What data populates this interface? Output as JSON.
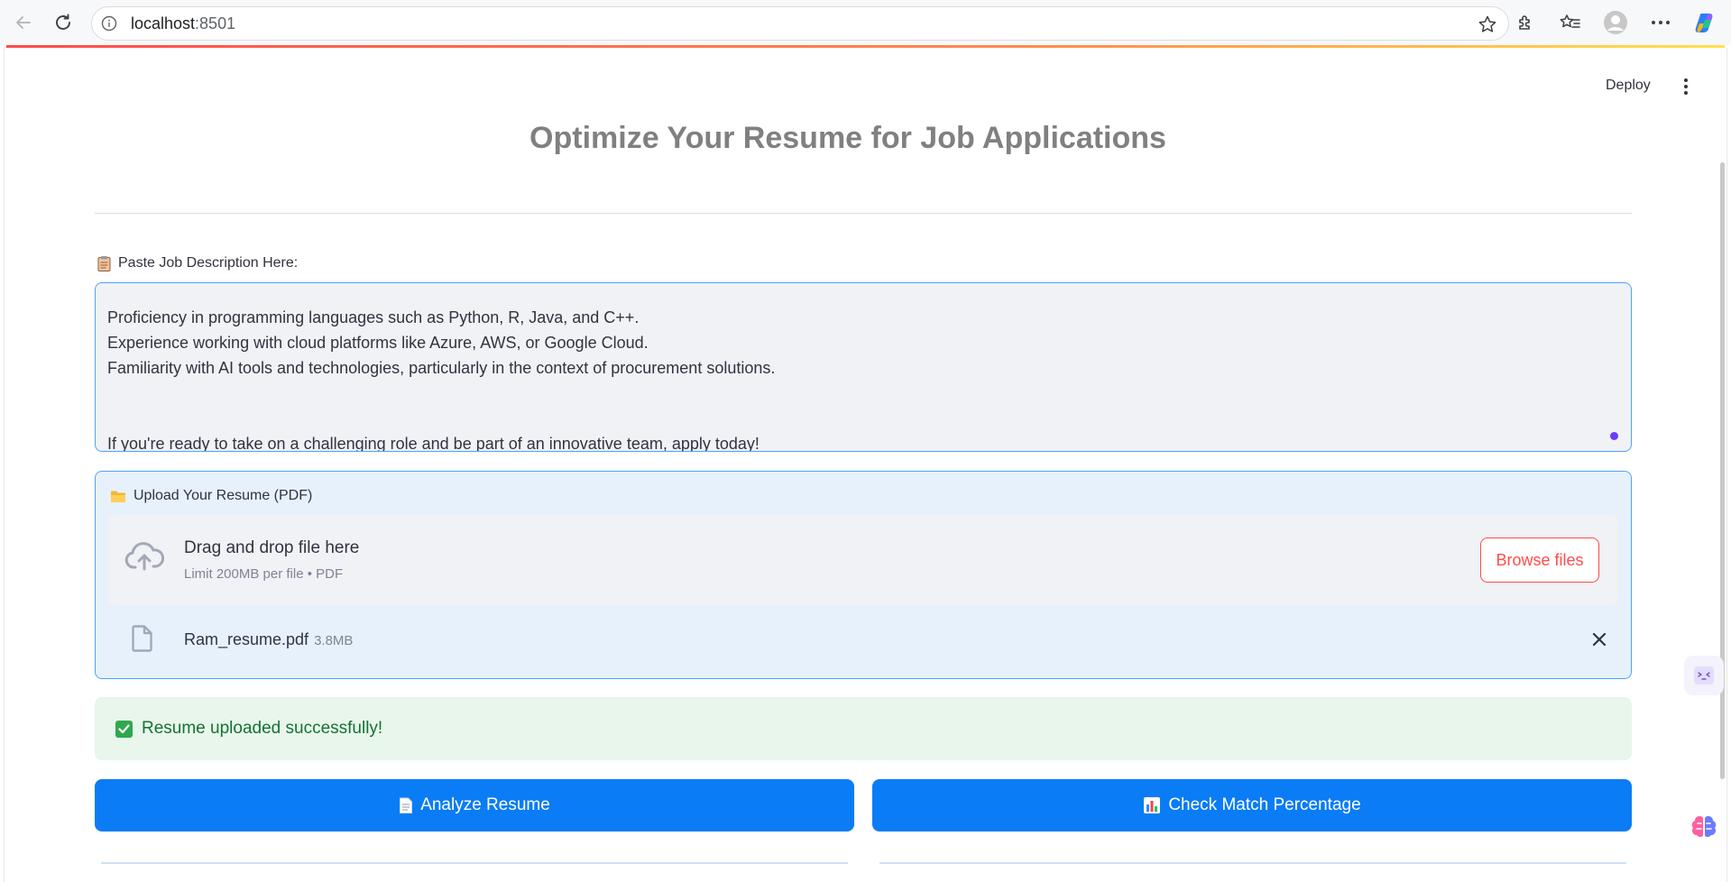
{
  "browser": {
    "url_host": "localhost",
    "url_port": ":8501"
  },
  "app": {
    "deploy_label": "Deploy",
    "title": "Optimize Your Resume for Job Applications",
    "jd_label": "Paste Job Description Here:",
    "jd_lines": [
      "Proficiency in programming languages such as Python, R, Java, and C++.",
      "Experience working with cloud platforms like Azure, AWS, or Google Cloud.",
      "Familiarity with AI tools and technologies, particularly in the context of procurement solutions.",
      "",
      "",
      "If you're ready to take on a challenging role and be part of an innovative team, apply today!"
    ],
    "upload_label": "Upload Your Resume (PDF)",
    "dropzone_title": "Drag and drop file here",
    "dropzone_sub": "Limit 200MB per file • PDF",
    "browse_label": "Browse files",
    "file_name": "Ram_resume.pdf",
    "file_size": "3.8MB",
    "success_text": "Resume uploaded successfully!",
    "analyze_label": "Analyze Resume",
    "match_label": "Check Match Percentage"
  },
  "icons": {
    "jd_emoji": "clipboard-icon",
    "upload_emoji": "folder-icon",
    "analyze_emoji": "page-icon",
    "match_emoji": "bar-chart-icon"
  },
  "colors": {
    "primary": "#0a7cf5",
    "accent_red": "#ff4b4b",
    "success_bg": "#e8f6ec",
    "success_text": "#177233",
    "focus_border": "#4da3ff"
  }
}
